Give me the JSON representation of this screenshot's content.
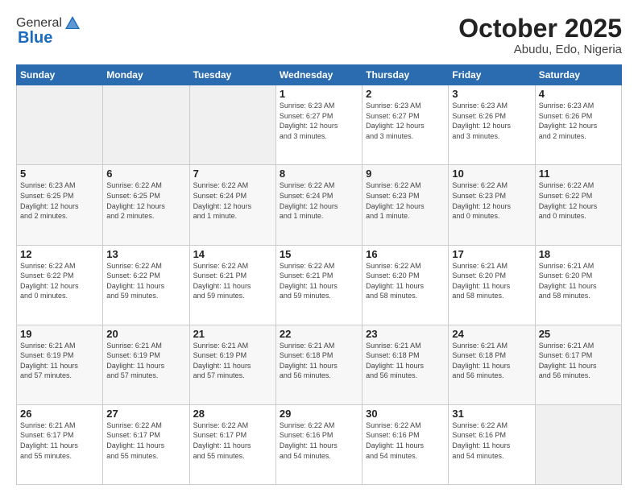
{
  "header": {
    "logo_general": "General",
    "logo_blue": "Blue",
    "title": "October 2025",
    "subtitle": "Abudu, Edo, Nigeria"
  },
  "days_of_week": [
    "Sunday",
    "Monday",
    "Tuesday",
    "Wednesday",
    "Thursday",
    "Friday",
    "Saturday"
  ],
  "weeks": [
    [
      {
        "day": "",
        "info": ""
      },
      {
        "day": "",
        "info": ""
      },
      {
        "day": "",
        "info": ""
      },
      {
        "day": "1",
        "info": "Sunrise: 6:23 AM\nSunset: 6:27 PM\nDaylight: 12 hours\nand 3 minutes."
      },
      {
        "day": "2",
        "info": "Sunrise: 6:23 AM\nSunset: 6:27 PM\nDaylight: 12 hours\nand 3 minutes."
      },
      {
        "day": "3",
        "info": "Sunrise: 6:23 AM\nSunset: 6:26 PM\nDaylight: 12 hours\nand 3 minutes."
      },
      {
        "day": "4",
        "info": "Sunrise: 6:23 AM\nSunset: 6:26 PM\nDaylight: 12 hours\nand 2 minutes."
      }
    ],
    [
      {
        "day": "5",
        "info": "Sunrise: 6:23 AM\nSunset: 6:25 PM\nDaylight: 12 hours\nand 2 minutes."
      },
      {
        "day": "6",
        "info": "Sunrise: 6:22 AM\nSunset: 6:25 PM\nDaylight: 12 hours\nand 2 minutes."
      },
      {
        "day": "7",
        "info": "Sunrise: 6:22 AM\nSunset: 6:24 PM\nDaylight: 12 hours\nand 1 minute."
      },
      {
        "day": "8",
        "info": "Sunrise: 6:22 AM\nSunset: 6:24 PM\nDaylight: 12 hours\nand 1 minute."
      },
      {
        "day": "9",
        "info": "Sunrise: 6:22 AM\nSunset: 6:23 PM\nDaylight: 12 hours\nand 1 minute."
      },
      {
        "day": "10",
        "info": "Sunrise: 6:22 AM\nSunset: 6:23 PM\nDaylight: 12 hours\nand 0 minutes."
      },
      {
        "day": "11",
        "info": "Sunrise: 6:22 AM\nSunset: 6:22 PM\nDaylight: 12 hours\nand 0 minutes."
      }
    ],
    [
      {
        "day": "12",
        "info": "Sunrise: 6:22 AM\nSunset: 6:22 PM\nDaylight: 12 hours\nand 0 minutes."
      },
      {
        "day": "13",
        "info": "Sunrise: 6:22 AM\nSunset: 6:22 PM\nDaylight: 11 hours\nand 59 minutes."
      },
      {
        "day": "14",
        "info": "Sunrise: 6:22 AM\nSunset: 6:21 PM\nDaylight: 11 hours\nand 59 minutes."
      },
      {
        "day": "15",
        "info": "Sunrise: 6:22 AM\nSunset: 6:21 PM\nDaylight: 11 hours\nand 59 minutes."
      },
      {
        "day": "16",
        "info": "Sunrise: 6:22 AM\nSunset: 6:20 PM\nDaylight: 11 hours\nand 58 minutes."
      },
      {
        "day": "17",
        "info": "Sunrise: 6:21 AM\nSunset: 6:20 PM\nDaylight: 11 hours\nand 58 minutes."
      },
      {
        "day": "18",
        "info": "Sunrise: 6:21 AM\nSunset: 6:20 PM\nDaylight: 11 hours\nand 58 minutes."
      }
    ],
    [
      {
        "day": "19",
        "info": "Sunrise: 6:21 AM\nSunset: 6:19 PM\nDaylight: 11 hours\nand 57 minutes."
      },
      {
        "day": "20",
        "info": "Sunrise: 6:21 AM\nSunset: 6:19 PM\nDaylight: 11 hours\nand 57 minutes."
      },
      {
        "day": "21",
        "info": "Sunrise: 6:21 AM\nSunset: 6:19 PM\nDaylight: 11 hours\nand 57 minutes."
      },
      {
        "day": "22",
        "info": "Sunrise: 6:21 AM\nSunset: 6:18 PM\nDaylight: 11 hours\nand 56 minutes."
      },
      {
        "day": "23",
        "info": "Sunrise: 6:21 AM\nSunset: 6:18 PM\nDaylight: 11 hours\nand 56 minutes."
      },
      {
        "day": "24",
        "info": "Sunrise: 6:21 AM\nSunset: 6:18 PM\nDaylight: 11 hours\nand 56 minutes."
      },
      {
        "day": "25",
        "info": "Sunrise: 6:21 AM\nSunset: 6:17 PM\nDaylight: 11 hours\nand 56 minutes."
      }
    ],
    [
      {
        "day": "26",
        "info": "Sunrise: 6:21 AM\nSunset: 6:17 PM\nDaylight: 11 hours\nand 55 minutes."
      },
      {
        "day": "27",
        "info": "Sunrise: 6:22 AM\nSunset: 6:17 PM\nDaylight: 11 hours\nand 55 minutes."
      },
      {
        "day": "28",
        "info": "Sunrise: 6:22 AM\nSunset: 6:17 PM\nDaylight: 11 hours\nand 55 minutes."
      },
      {
        "day": "29",
        "info": "Sunrise: 6:22 AM\nSunset: 6:16 PM\nDaylight: 11 hours\nand 54 minutes."
      },
      {
        "day": "30",
        "info": "Sunrise: 6:22 AM\nSunset: 6:16 PM\nDaylight: 11 hours\nand 54 minutes."
      },
      {
        "day": "31",
        "info": "Sunrise: 6:22 AM\nSunset: 6:16 PM\nDaylight: 11 hours\nand 54 minutes."
      },
      {
        "day": "",
        "info": ""
      }
    ]
  ]
}
